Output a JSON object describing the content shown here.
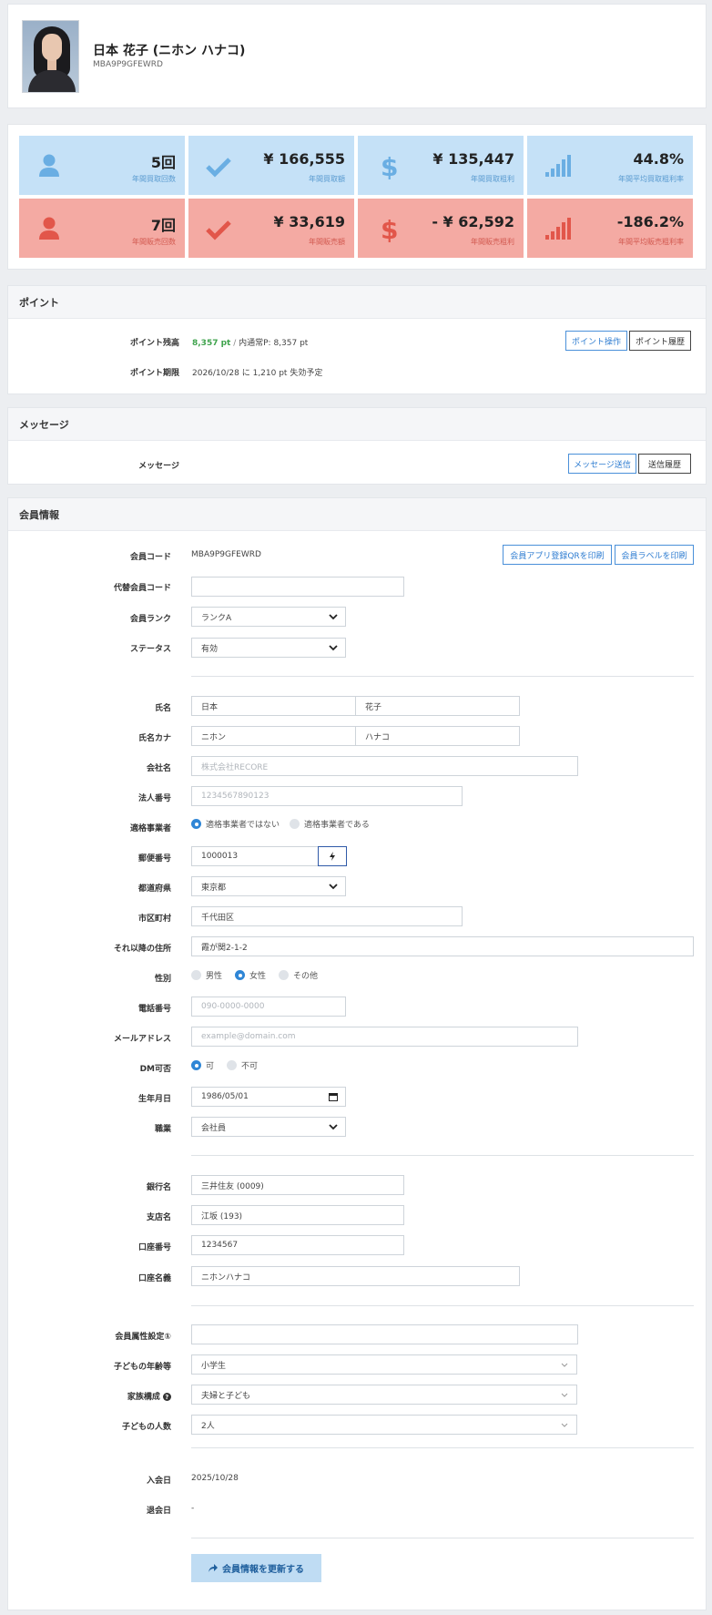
{
  "profile": {
    "name": "日本 花子 (ニホン ハナコ)",
    "code": "MBA9P9GFEWRD"
  },
  "stats": {
    "buy": [
      {
        "icon": "user-icon",
        "value": "5回",
        "label": "年間買取回数"
      },
      {
        "icon": "check-icon",
        "value": "¥ 166,555",
        "label": "年間買取額"
      },
      {
        "icon": "dollar-icon",
        "value": "¥ 135,447",
        "label": "年間買取粗利"
      },
      {
        "icon": "signal-icon",
        "value": "44.8%",
        "label": "年間平均買取粗利率"
      }
    ],
    "sell": [
      {
        "icon": "user-icon",
        "value": "7回",
        "label": "年間販売回数"
      },
      {
        "icon": "check-icon",
        "value": "¥ 33,619",
        "label": "年間販売額"
      },
      {
        "icon": "dollar-icon",
        "value": "- ¥ 62,592",
        "label": "年間販売粗利"
      },
      {
        "icon": "signal-icon",
        "value": "-186.2%",
        "label": "年間平均販売粗利率"
      }
    ],
    "colors": {
      "blue_bg": "#c5e1f7",
      "red_bg": "#f4aaa3",
      "blue_icon": "#6aaee3",
      "red_icon": "#e2564a"
    }
  },
  "points": {
    "title": "ポイント",
    "balance_label": "ポイント残高",
    "balance_value": "8,357 pt",
    "balance_sep": " / ",
    "balance_detail": "内通常P: 8,357 pt",
    "expiry_label": "ポイント期限",
    "expiry_value": "2026/10/28 に 1,210 pt 失効予定",
    "operate_button": "ポイント操作",
    "history_button": "ポイント履歴"
  },
  "message": {
    "title": "メッセージ",
    "label": "メッセージ",
    "send_button": "メッセージ送信",
    "history_button": "送信履歴"
  },
  "member": {
    "title": "会員情報",
    "code_label": "会員コード",
    "code_value": "MBA9P9GFEWRD",
    "qr_button": "会員アプリ登録QRを印刷",
    "label_button": "会員ラベルを印刷",
    "alt_code_label": "代替会員コード",
    "alt_code_value": "",
    "rank_label": "会員ランク",
    "rank_value": "ランクA",
    "status_label": "ステータス",
    "status_value": "有効",
    "name_label": "氏名",
    "last_name": "日本",
    "first_name": "花子",
    "kana_label": "氏名カナ",
    "last_kana": "ニホン",
    "first_kana": "ハナコ",
    "company_label": "会社名",
    "company_placeholder": "株式会社RECORE",
    "corp_no_label": "法人番号",
    "corp_no_placeholder": "1234567890123",
    "invoice_label": "適格事業者",
    "invoice_opt1": "適格事業者ではない",
    "invoice_opt2": "適格事業者である",
    "zip_label": "郵便番号",
    "zip_value": "1000013",
    "pref_label": "都道府県",
    "pref_value": "東京都",
    "city_label": "市区町村",
    "city_value": "千代田区",
    "addr_label": "それ以降の住所",
    "addr_value": "霞が関2-1-2",
    "gender_label": "性別",
    "gender_opts": [
      "男性",
      "女性",
      "その他"
    ],
    "phone_label": "電話番号",
    "phone_placeholder": "090-0000-0000",
    "email_label": "メールアドレス",
    "email_placeholder": "example@domain.com",
    "dm_label": "DM可否",
    "dm_opts": [
      "可",
      "不可"
    ],
    "birth_label": "生年月日",
    "birth_value": "1986/05/01",
    "job_label": "職業",
    "job_value": "会社員",
    "bank_label": "銀行名",
    "bank_value": "三井住友 (0009)",
    "branch_label": "支店名",
    "branch_value": "江坂 (193)",
    "account_label": "口座番号",
    "account_value": "1234567",
    "holder_label": "口座名義",
    "holder_value": "ニホンハナコ",
    "attr_label": "会員属性設定①",
    "attr_value": "",
    "child_age_label": "子どもの年齢等",
    "child_age_value": "小学生",
    "family_label": "家族構成",
    "family_value": "夫婦と子ども",
    "child_count_label": "子どもの人数",
    "child_count_value": "2人",
    "join_label": "入会日",
    "join_value": "2025/10/28",
    "leave_label": "退会日",
    "leave_value": "-",
    "submit_button": "会員情報を更新する"
  }
}
